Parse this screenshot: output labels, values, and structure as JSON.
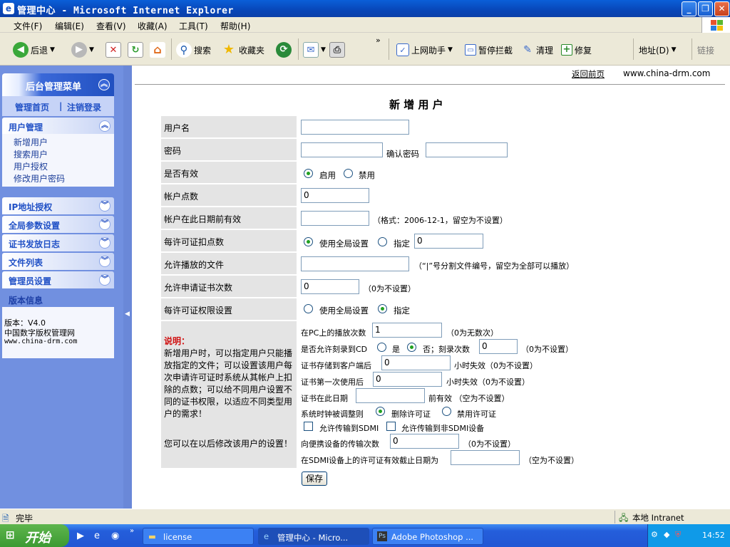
{
  "window": {
    "title": "管理中心 - Microsoft Internet Explorer"
  },
  "menu": [
    "文件(F)",
    "编辑(E)",
    "查看(V)",
    "收藏(A)",
    "工具(T)",
    "帮助(H)"
  ],
  "toolbar": {
    "back": "后退",
    "search": "搜索",
    "favorites": "收藏夹",
    "helper": "上网助手",
    "block": "暂停拦截",
    "clean": "清理",
    "repair": "修复",
    "address": "地址(D)",
    "links": "链接"
  },
  "sidebar": {
    "header": "后台管理菜单",
    "home_link": "管理首页",
    "logout_link": "注销登录",
    "sections": [
      {
        "label": "用户管理",
        "expanded": true,
        "items": [
          "新增用户",
          "搜索用户",
          "用户授权",
          "修改用户密码"
        ]
      },
      {
        "label": "IP地址授权"
      },
      {
        "label": "全局参数设置"
      },
      {
        "label": "证书发放日志"
      },
      {
        "label": "文件列表"
      },
      {
        "label": "管理员设置"
      }
    ],
    "version_title": "版本信息",
    "version": "版本：V4.0",
    "org": "中国数字版权管理网",
    "site": "www.china-drm.com"
  },
  "top": {
    "back_link": "返回前页",
    "site": "www.china-drm.com"
  },
  "form": {
    "title": "新 增 用 户",
    "username_label": "用户名",
    "username_value": "",
    "password_label": "密码",
    "confirm_label": "确认密码",
    "enabled_label": "是否有效",
    "enabled_on": "启用",
    "enabled_off": "禁用",
    "points_label": "帐户点数",
    "points_value": "0",
    "expire_label": "帐户在此日期前有效",
    "expire_hint": "（格式：2006-12-1，留空为不设置）",
    "deduct_label": "每许可证扣点数",
    "deduct_global": "使用全局设置",
    "deduct_specify": "指定",
    "deduct_value": "0",
    "files_label": "允许播放的文件",
    "files_hint": "（“|”号分割文件编号，留空为全部可以播放）",
    "apply_label": "允许申请证书次数",
    "apply_value": "0",
    "apply_hint": "（0为不设置）",
    "perm_label": "每许可证权限设置",
    "perm_global": "使用全局设置",
    "perm_specify": "指定",
    "note_title": "说明：",
    "note_body": "新增用户时，可以指定用户只能播放指定的文件；可以设置该用户每次申请许可证时系统从其帐户上扣除的点数；可以给不同用户设置不同的证书权限，以适应不同类型用户的需求！",
    "note_tail": "您可以在以后修改该用户的设置！",
    "pc_plays": "在PC上的播放次数",
    "pc_plays_value": "1",
    "pc_plays_hint": "（0为无数次）",
    "burn": "是否允许刻录到CD",
    "burn_yes": "是",
    "burn_no": "否；刻录次数",
    "burn_value": "0",
    "burn_hint": "（0为不设置）",
    "store": "证书存储到客户端后",
    "store_value": "0",
    "store_hint": "小时失效（0为不设置）",
    "first_use": "证书第一次使用后",
    "first_use_value": "0",
    "first_use_hint": "小时失效（0为不设置）",
    "before_date": "证书在此日期",
    "before_date_hint": "前有效 （空为不设置）",
    "clock": "系统时钟被调整则",
    "clock_delete": "删除许可证",
    "clock_disable": "禁用许可证",
    "sdmi": "允许传输到SDMI",
    "non_sdmi": "允许传输到非SDMI设备",
    "portable": "向便携设备的传输次数",
    "portable_value": "0",
    "portable_hint": "（0为不设置）",
    "sdmi_expire": "在SDMI设备上的许可证有效截止日期为",
    "sdmi_expire_hint": "（空为不设置）",
    "save": "保存"
  },
  "status": {
    "text": "完毕",
    "zone": "本地 Intranet"
  },
  "taskbar": {
    "start": "开始",
    "tasks": [
      "license",
      "管理中心 - Micro...",
      "Adobe Photoshop ..."
    ],
    "time": "14:52"
  }
}
